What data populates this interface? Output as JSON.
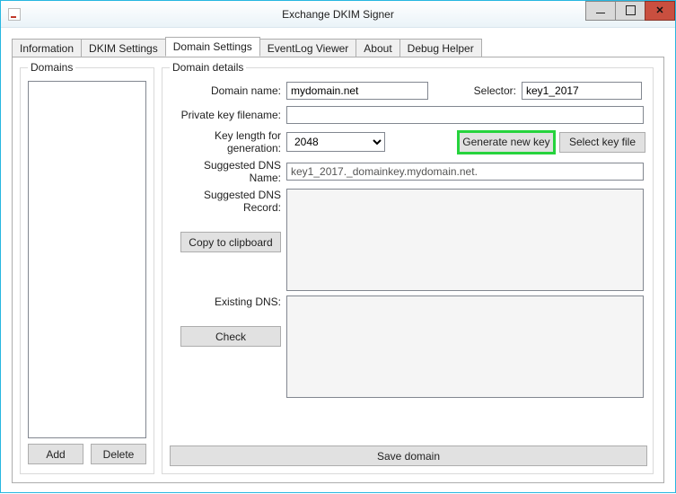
{
  "window": {
    "title": "Exchange DKIM Signer"
  },
  "tabs": {
    "information": "Information",
    "dkim_settings": "DKIM Settings",
    "domain_settings": "Domain Settings",
    "eventlog_viewer": "EventLog Viewer",
    "about": "About",
    "debug_helper": "Debug Helper"
  },
  "domains_panel": {
    "legend": "Domains",
    "add_label": "Add",
    "delete_label": "Delete"
  },
  "details": {
    "legend": "Domain details",
    "domain_name_label": "Domain name:",
    "domain_name_value": "mydomain.net",
    "selector_label": "Selector:",
    "selector_value": "key1_2017",
    "private_key_label": "Private key filename:",
    "private_key_value": "",
    "key_length_label": "Key length for generation:",
    "key_length_value": "2048",
    "generate_label": "Generate new key",
    "select_file_label": "Select key file",
    "dns_name_label": "Suggested DNS Name:",
    "dns_name_value": "key1_2017._domainkey.mydomain.net.",
    "dns_record_label": "Suggested DNS Record:",
    "dns_record_value": "",
    "copy_label": "Copy to clipboard",
    "existing_dns_label": "Existing DNS:",
    "existing_dns_value": "",
    "check_label": "Check",
    "save_label": "Save domain"
  }
}
